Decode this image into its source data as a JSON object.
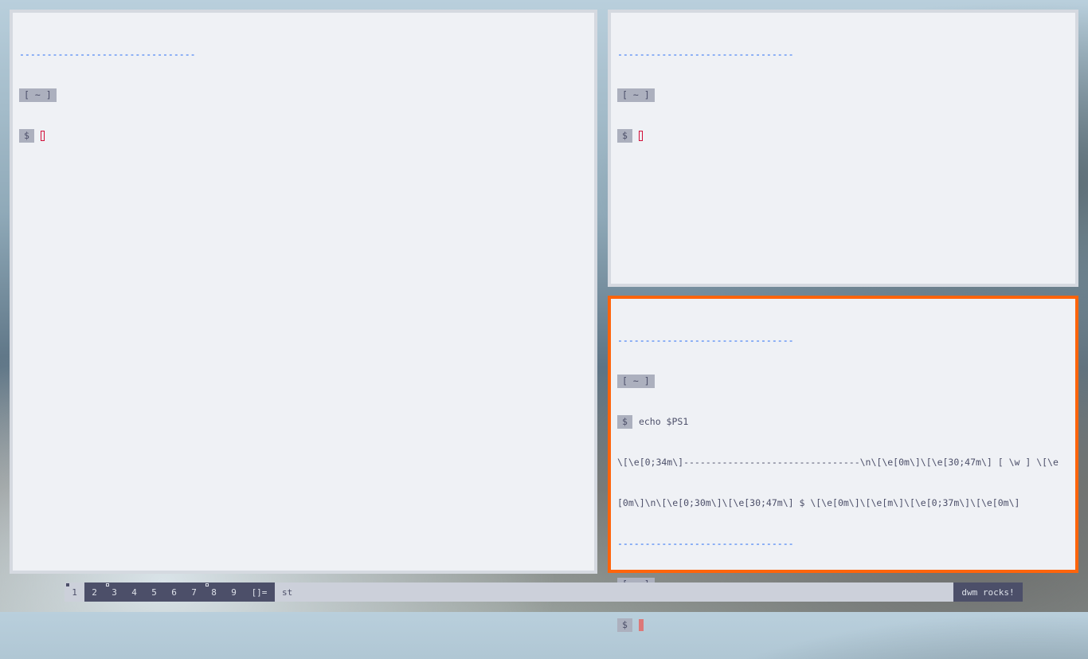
{
  "terminals": [
    {
      "separator": "--------------------------------",
      "dir_label": "[ ~ ]",
      "prompt": "$"
    },
    {
      "separator": "--------------------------------",
      "dir_label": "[ ~ ]",
      "prompt": "$"
    },
    {
      "separator": "--------------------------------",
      "dir_label": "[ ~ ]",
      "prompt": "$",
      "command": "echo $PS1",
      "output_line1": "\\[\\e[0;34m\\]--------------------------------\\n\\[\\e[0m\\]\\[\\e[30;47m\\] [ \\w ] \\[\\e",
      "output_line2": "[0m\\]\\n\\[\\e[0;30m\\]\\[\\e[30;47m\\] $ \\[\\e[0m\\]\\[\\e[m\\]\\[\\e[0;37m\\]\\[\\e[0m\\]",
      "separator2": "--------------------------------",
      "dir_label2": "[ ~ ]",
      "prompt2": "$"
    }
  ],
  "bar": {
    "tags": [
      "1",
      "2",
      "3",
      "4",
      "5",
      "6",
      "7",
      "8",
      "9"
    ],
    "layout_symbol": "[]=",
    "window_title": "st",
    "status_text": "dwm rocks!"
  },
  "colors": {
    "focused_border": "#fe640b",
    "unfocused_border": "#d5d9e0",
    "terminal_bg": "#eff1f5",
    "separator": "#1e66f5"
  }
}
